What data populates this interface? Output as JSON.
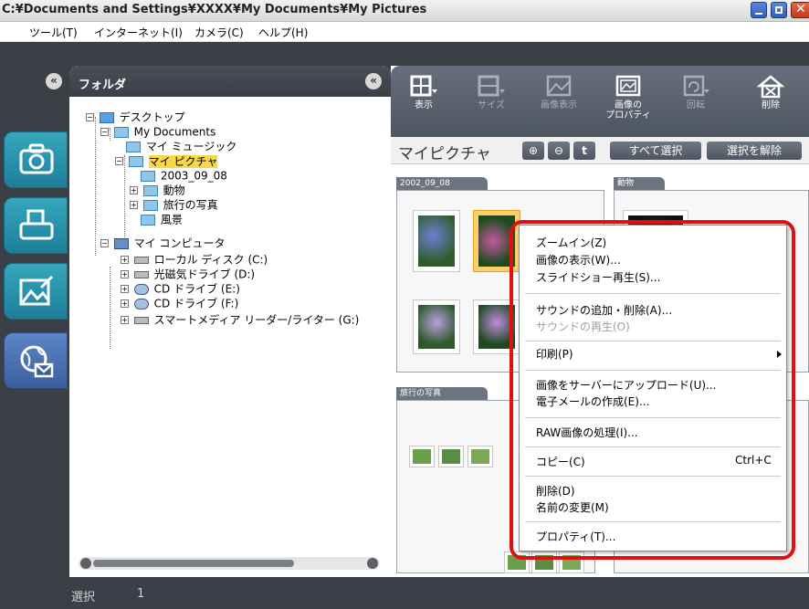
{
  "window": {
    "title": "C:¥Documents and Settings¥XXXX¥My Documents¥My Pictures"
  },
  "menubar": {
    "items": [
      "ツール(T)",
      "インターネット(I)",
      "カメラ(C)",
      "ヘルプ(H)"
    ]
  },
  "folder_panel": {
    "title": "フォルダ",
    "tree": [
      {
        "label": "デスクトップ",
        "expander": "−"
      },
      {
        "label": "My Documents",
        "expander": "−"
      },
      {
        "label": "マイ ミュージック",
        "expander": ""
      },
      {
        "label": "マイ ピクチャ",
        "expander": "−"
      },
      {
        "label": "2003_09_08",
        "expander": ""
      },
      {
        "label": "動物",
        "expander": "+"
      },
      {
        "label": "旅行の写真",
        "expander": "+"
      },
      {
        "label": "風景",
        "expander": ""
      },
      {
        "label": "マイ コンピュータ",
        "expander": "−"
      },
      {
        "label": "ローカル ディスク (C:)",
        "expander": "+"
      },
      {
        "label": "光磁気ドライブ (D:)",
        "expander": "+"
      },
      {
        "label": "CD ドライブ (E:)",
        "expander": "+"
      },
      {
        "label": "CD ドライブ (F:)",
        "expander": "+"
      },
      {
        "label": "スマートメディア リーダー/ライター (G:)",
        "expander": "+"
      }
    ]
  },
  "toolbar": {
    "tools": [
      {
        "label": "表示",
        "icon": "view-icon",
        "enabled": true
      },
      {
        "label": "サイズ",
        "icon": "size-icon",
        "enabled": false
      },
      {
        "label": "画像表示",
        "icon": "image-view-icon",
        "enabled": false
      },
      {
        "label": "画像の\nプロパティ",
        "icon": "image-properties-icon",
        "enabled": true
      },
      {
        "label": "回転",
        "icon": "rotate-icon",
        "enabled": false
      },
      {
        "label": "削除",
        "icon": "delete-icon",
        "enabled": true
      }
    ]
  },
  "location": {
    "title": "マイピクチャ",
    "select_all": "すべて選択",
    "deselect": "選択を解除",
    "zoom_in_icon": "zoom-in-icon",
    "zoom_out_icon": "zoom-out-icon",
    "up_icon": "up-arrow-icon"
  },
  "groups": [
    {
      "label": "2002_09_08"
    },
    {
      "label": "動物"
    },
    {
      "label": "旅行の写真"
    }
  ],
  "context_menu": {
    "items": [
      {
        "label": "ズームイン(Z)",
        "enabled": true
      },
      {
        "label": "画像の表示(W)...",
        "enabled": true
      },
      {
        "label": "スライドショー再生(S)...",
        "enabled": true
      },
      {
        "label": "サウンドの追加・削除(A)...",
        "enabled": true
      },
      {
        "label": "サウンドの再生(O)",
        "enabled": false
      },
      {
        "label": "印刷(P)",
        "enabled": true
      },
      {
        "label": "画像をサーバーにアップロード(U)...",
        "enabled": true
      },
      {
        "label": "電子メールの作成(E)...",
        "enabled": true
      },
      {
        "label": "RAW画像の処理(I)...",
        "enabled": true
      },
      {
        "label": "コピー(C)",
        "enabled": true,
        "shortcut": "Ctrl+C"
      },
      {
        "label": "削除(D)",
        "enabled": true
      },
      {
        "label": "名前の変更(M)",
        "enabled": true
      },
      {
        "label": "プロパティ(T)...",
        "enabled": true
      }
    ]
  },
  "statusbar": {
    "label": "選択",
    "count": "1"
  },
  "colors": {
    "accent_highlight": "#e01010",
    "selection": "#f7d84a",
    "rail": "#2b8fab"
  }
}
